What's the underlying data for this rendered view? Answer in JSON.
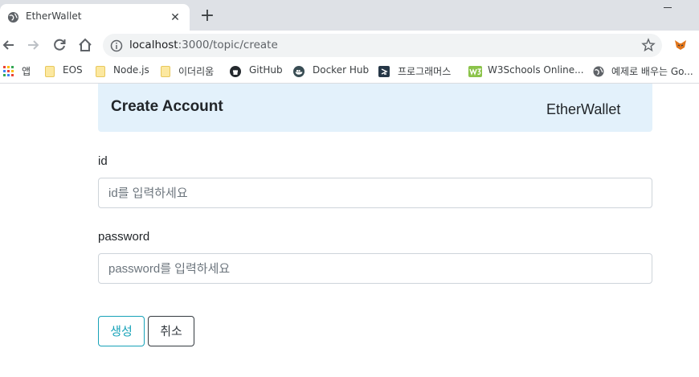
{
  "browser": {
    "tab": {
      "title": "EtherWallet",
      "close_glyph": "✕"
    },
    "new_tab_glyph": "+",
    "address": {
      "host": "localhost",
      "rest": ":3000/topic/create"
    },
    "bookmarks": [
      {
        "label": "앱",
        "icon": "apps-grid-icon"
      },
      {
        "label": "EOS",
        "icon": "folder-icon"
      },
      {
        "label": "Node.js",
        "icon": "folder-icon"
      },
      {
        "label": "이더리움",
        "icon": "folder-icon"
      },
      {
        "label": "GitHub",
        "icon": "github-icon"
      },
      {
        "label": "Docker Hub",
        "icon": "docker-icon"
      },
      {
        "label": "프로그래머스",
        "icon": "programmers-icon"
      },
      {
        "label": "W3Schools Online...",
        "icon": "w3schools-icon"
      },
      {
        "label": "예제로 배우는 Go...",
        "icon": "globe-icon"
      }
    ]
  },
  "page": {
    "header": {
      "title": "Create Account",
      "brand": "EtherWallet"
    },
    "form": {
      "id": {
        "label": "id",
        "value": "",
        "placeholder": "id를 입력하세요"
      },
      "password": {
        "label": "password",
        "value": "",
        "placeholder": "password를 입력하세요"
      }
    },
    "buttons": {
      "create": "생성",
      "cancel": "취소"
    }
  },
  "colors": {
    "header_bg": "#e3f1fb",
    "create_button": "#17a2b8",
    "cancel_button": "#343a40",
    "tabstrip_bg": "#dee1e6"
  }
}
